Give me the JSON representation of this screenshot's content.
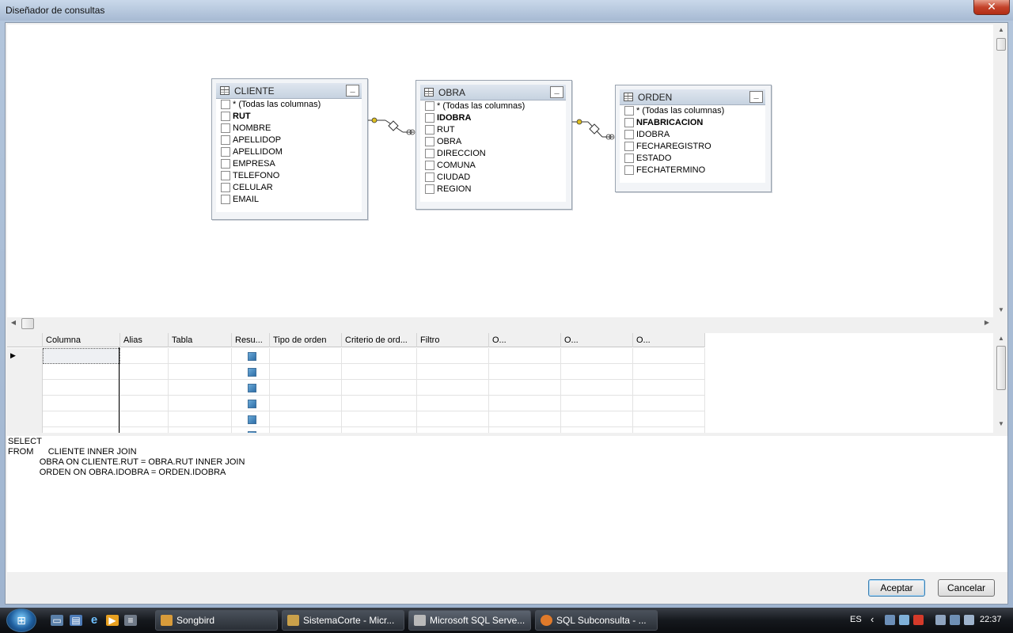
{
  "window": {
    "title": "Diseñador de consultas",
    "close_label": "✕"
  },
  "tables": [
    {
      "name": "CLIENTE",
      "columns": [
        {
          "label": "* (Todas las columnas)",
          "key": false
        },
        {
          "label": "RUT",
          "key": true
        },
        {
          "label": "NOMBRE",
          "key": false
        },
        {
          "label": "APELLIDOP",
          "key": false
        },
        {
          "label": "APELLIDOM",
          "key": false
        },
        {
          "label": "EMPRESA",
          "key": false
        },
        {
          "label": "TELEFONO",
          "key": false
        },
        {
          "label": "CELULAR",
          "key": false
        },
        {
          "label": "EMAIL",
          "key": false
        }
      ]
    },
    {
      "name": "OBRA",
      "columns": [
        {
          "label": "* (Todas las columnas)",
          "key": false
        },
        {
          "label": "IDOBRA",
          "key": true
        },
        {
          "label": "RUT",
          "key": false
        },
        {
          "label": "OBRA",
          "key": false
        },
        {
          "label": "DIRECCION",
          "key": false
        },
        {
          "label": "COMUNA",
          "key": false
        },
        {
          "label": "CIUDAD",
          "key": false
        },
        {
          "label": "REGION",
          "key": false
        }
      ]
    },
    {
      "name": "ORDEN",
      "columns": [
        {
          "label": "* (Todas las columnas)",
          "key": false
        },
        {
          "label": "NFABRICACION",
          "key": true
        },
        {
          "label": "IDOBRA",
          "key": false
        },
        {
          "label": "FECHAREGISTRO",
          "key": false
        },
        {
          "label": "ESTADO",
          "key": false
        },
        {
          "label": "FECHATERMINO",
          "key": false
        }
      ]
    }
  ],
  "grid": {
    "headers": [
      "Columna",
      "Alias",
      "Tabla",
      "Resu...",
      "Tipo de orden",
      "Criterio de ord...",
      "Filtro",
      "O...",
      "O...",
      "O..."
    ]
  },
  "sql": {
    "lines": [
      "SELECT",
      "FROM      CLIENTE INNER JOIN",
      "             OBRA ON CLIENTE.RUT = OBRA.RUT INNER JOIN",
      "             ORDEN ON OBRA.IDOBRA = ORDEN.IDOBRA"
    ]
  },
  "buttons": {
    "ok": "Aceptar",
    "cancel": "Cancelar"
  },
  "taskbar": {
    "tasks": [
      {
        "label": "Songbird",
        "color": "#d89b3a"
      },
      {
        "label": "SistemaCorte - Micr...",
        "color": "#c9a04a"
      },
      {
        "label": "Microsoft SQL Serve...",
        "color": "#b9b9b9"
      },
      {
        "label": "SQL Subconsulta - ...",
        "color": "#e07a2a"
      }
    ],
    "language": "ES",
    "time": "22:37"
  }
}
